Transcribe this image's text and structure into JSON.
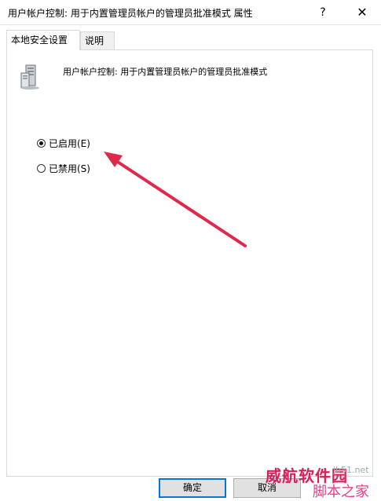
{
  "window": {
    "title": "用户帐户控制: 用于内置管理员帐户的管理员批准模式 属性",
    "help_label": "?",
    "close_label": "✕"
  },
  "tabs": [
    {
      "label": "本地安全设置",
      "active": true
    },
    {
      "label": "说明",
      "active": false
    }
  ],
  "policy": {
    "icon": "server-icon",
    "title": "用户帐户控制: 用于内置管理员帐户的管理员批准模式"
  },
  "options": {
    "enabled_label": "已启用(E)",
    "disabled_label": "已禁用(S)",
    "selected": "enabled"
  },
  "buttons": {
    "ok_label": "确定",
    "cancel_label": "取消"
  },
  "watermark": {
    "cn_text": "威航软件园",
    "site_text": "脚本之家",
    "small_text": "jb51.net"
  },
  "colors": {
    "arrow": "#e0294a",
    "focus": "#0078d7"
  }
}
